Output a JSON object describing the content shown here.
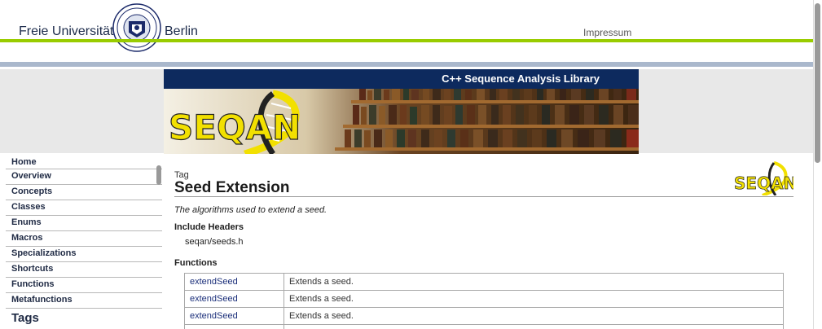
{
  "header": {
    "left_text": "Freie Universität",
    "right_text": "Berlin",
    "impressum": "Impressum"
  },
  "banner": {
    "title": "C++ Sequence Analysis Library",
    "logo_text": "SEQAN"
  },
  "sidebar": {
    "items": [
      {
        "label": "Home"
      },
      {
        "label": "Overview"
      },
      {
        "label": "Concepts"
      },
      {
        "label": "Classes"
      },
      {
        "label": "Enums"
      },
      {
        "label": "Macros"
      },
      {
        "label": "Specializations"
      },
      {
        "label": "Shortcuts"
      },
      {
        "label": "Functions"
      },
      {
        "label": "Metafunctions"
      }
    ],
    "tags_heading": "Tags"
  },
  "main": {
    "kind": "Tag",
    "title": "Seed Extension",
    "summary": "The algorithms used to extend a seed.",
    "include_heading": "Include Headers",
    "include_file": "seqan/seeds.h",
    "functions_heading": "Functions",
    "logo_text": "SEQAN",
    "functions": [
      {
        "name": "extendSeed",
        "description": "Extends a seed."
      },
      {
        "name": "extendSeed",
        "description": "Extends a seed."
      },
      {
        "name": "extendSeed",
        "description": "Extends a seed."
      },
      {
        "name": "",
        "description": ""
      }
    ]
  },
  "colors": {
    "fu_green": "#99cc00",
    "banner_navy": "#0d2a5e",
    "link": "#1b2f7a",
    "logo_yellow": "#f2e000"
  }
}
